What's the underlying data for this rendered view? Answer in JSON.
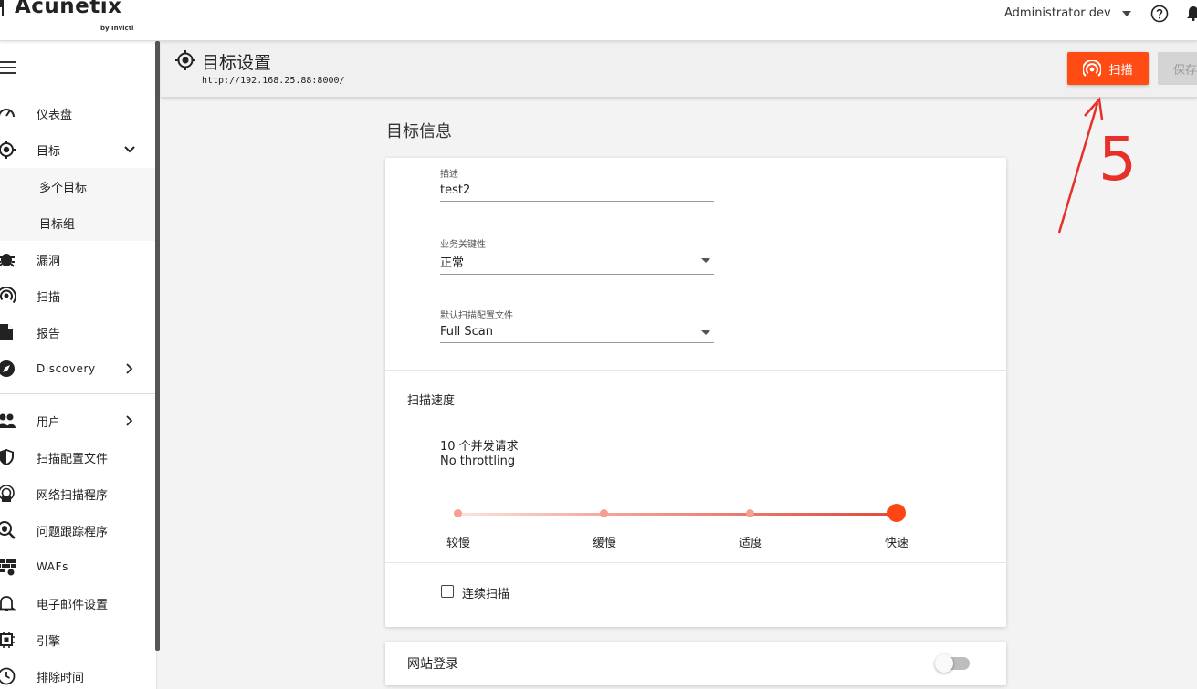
{
  "app": {
    "logo_text": "Acunetix",
    "logo_sub": "by Invicti",
    "brand_color": "#ff4b14"
  },
  "topbar": {
    "user": "Administrator dev",
    "help_icon": "question-circle-icon",
    "bell_icon": "bell-icon"
  },
  "sidebar": {
    "items": [
      {
        "label": "仪表盘",
        "icon": "gauge-icon"
      },
      {
        "label": "目标",
        "icon": "target-icon"
      },
      {
        "label": "多个目标"
      },
      {
        "label": "目标组"
      },
      {
        "label": "漏洞",
        "icon": "bug-icon"
      },
      {
        "label": "扫描",
        "icon": "radar-icon"
      },
      {
        "label": "报告",
        "icon": "document-icon"
      },
      {
        "label": "Discovery",
        "icon": "compass-icon"
      },
      {
        "label": "用户",
        "icon": "users-icon"
      },
      {
        "label": "扫描配置文件",
        "icon": "shield-icon"
      },
      {
        "label": "网络扫描程序",
        "icon": "network-scanner-icon"
      },
      {
        "label": "问题跟踪程序",
        "icon": "bug-search-icon"
      },
      {
        "label": "WAFs",
        "icon": "firewall-icon"
      },
      {
        "label": "电子邮件设置",
        "icon": "bell-outline-icon"
      },
      {
        "label": "引擎",
        "icon": "chip-icon"
      },
      {
        "label": "排除时间",
        "icon": "clock-icon"
      }
    ]
  },
  "header": {
    "title": "目标设置",
    "url": "http://192.168.25.88:8000/",
    "scan_label": "扫描",
    "save_label": "保存"
  },
  "target_info": {
    "section_title": "目标信息",
    "description_label": "描述",
    "description_value": "test2",
    "criticality_label": "业务关键性",
    "criticality_value": "正常",
    "profile_label": "默认扫描配置文件",
    "profile_value": "Full Scan"
  },
  "scan_speed": {
    "title": "扫描速度",
    "requests": "10 个并发请求",
    "throttling": "No throttling",
    "levels": [
      "较慢",
      "缓慢",
      "适度",
      "快速"
    ],
    "selected_index": 3
  },
  "continuous_scan": {
    "label": "连续扫描",
    "checked": false
  },
  "site_login": {
    "title": "网站登录",
    "enabled": false
  },
  "annotation": {
    "text": "5",
    "color": "#e8302a"
  }
}
